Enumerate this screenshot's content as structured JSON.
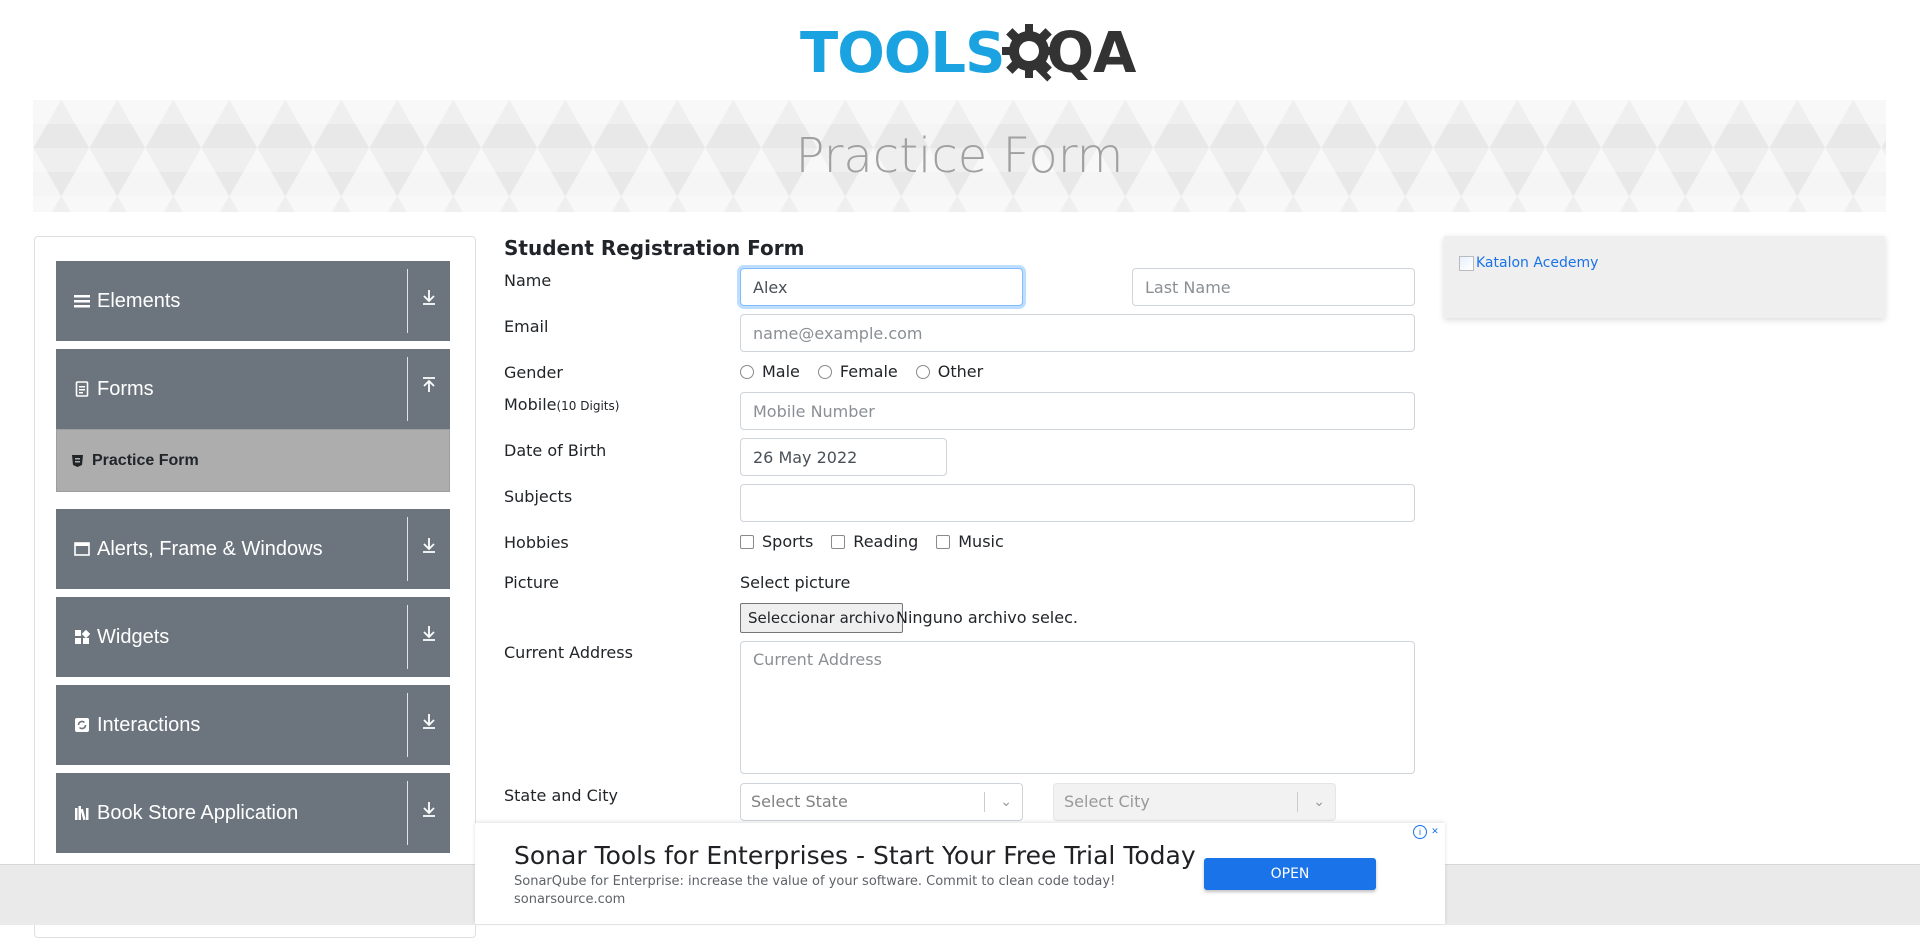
{
  "header": {
    "logo_left": "TOOLS",
    "logo_right": "QA",
    "banner_title": "Practice Form"
  },
  "sidebar": {
    "groups": [
      {
        "label": "Elements",
        "icon": "hamburger-icon",
        "state": "collapsed"
      },
      {
        "label": "Forms",
        "icon": "document-icon",
        "state": "expanded"
      },
      {
        "label": "Alerts, Frame & Windows",
        "icon": "window-icon",
        "state": "collapsed"
      },
      {
        "label": "Widgets",
        "icon": "grid-icon",
        "state": "collapsed"
      },
      {
        "label": "Interactions",
        "icon": "refresh-icon",
        "state": "collapsed"
      },
      {
        "label": "Book Store Application",
        "icon": "books-icon",
        "state": "collapsed"
      }
    ],
    "active_item": {
      "label": "Practice Form",
      "icon": "html5-icon"
    }
  },
  "form": {
    "title": "Student Registration Form",
    "name_label": "Name",
    "first_name_value": "Alex",
    "last_name_placeholder": "Last Name",
    "email_label": "Email",
    "email_placeholder": "name@example.com",
    "gender_label": "Gender",
    "gender_options": [
      "Male",
      "Female",
      "Other"
    ],
    "mobile_label": "Mobile",
    "mobile_hint": "(10 Digits)",
    "mobile_placeholder": "Mobile Number",
    "dob_label": "Date of Birth",
    "dob_value": "26 May 2022",
    "subjects_label": "Subjects",
    "hobbies_label": "Hobbies",
    "hobbies_options": [
      "Sports",
      "Reading",
      "Music"
    ],
    "picture_label": "Picture",
    "picture_prompt": "Select picture",
    "file_button": "Seleccionar archivo",
    "file_status": "Ninguno archivo selec.",
    "address_label": "Current Address",
    "address_placeholder": "Current Address",
    "state_city_label": "State and City",
    "state_placeholder": "Select State",
    "city_placeholder": "Select City"
  },
  "right_ad": {
    "alt_text": "Katalon Acedemy"
  },
  "bottom_ad": {
    "headline": "Sonar Tools for Enterprises - Start Your Free Trial Today",
    "description": "SonarQube for Enterprise: increase the value of your software. Commit to clean code today!",
    "url": "sonarsource.com",
    "button": "OPEN"
  },
  "colors": {
    "sidebar_bg": "#6c757d",
    "active_item_bg": "#adadad",
    "logo_blue": "#1aa3e0",
    "ad_button": "#1a73e8",
    "focus_border": "#80bdff"
  }
}
